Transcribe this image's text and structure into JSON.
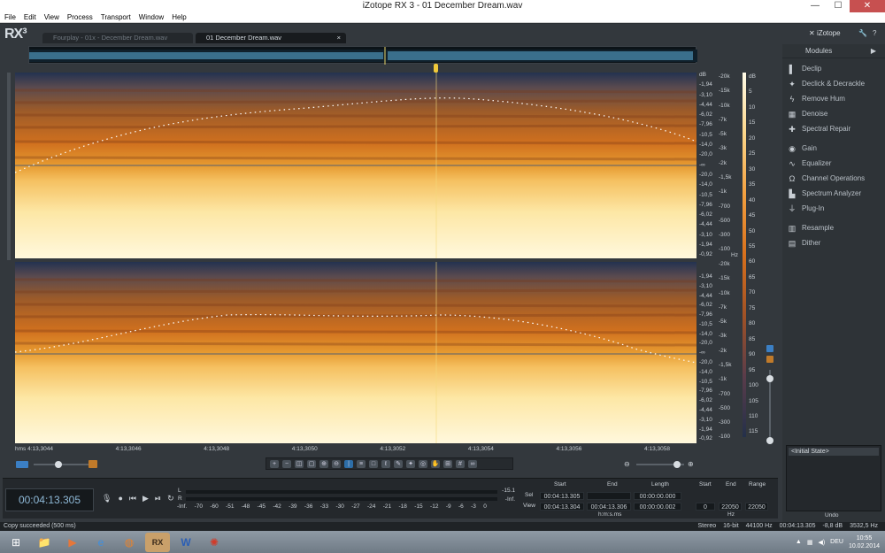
{
  "window": {
    "title": "iZotope RX 3 - 01 December Dream.wav",
    "controls": [
      "—",
      "☐",
      "✕"
    ]
  },
  "menu": [
    "File",
    "Edit",
    "View",
    "Process",
    "Transport",
    "Window",
    "Help"
  ],
  "app": {
    "logo": "RX³",
    "tabs": [
      {
        "label": "Fourplay - 01x - December Dream.wav",
        "active": false
      },
      {
        "label": "01 December Dream.wav",
        "active": true,
        "close": "×"
      }
    ],
    "brand": "iZotope"
  },
  "spectrogram": {
    "db_scale_top": [
      "dB",
      "-1,94",
      "-3,10",
      "-4,44",
      "-6,02",
      "-7,96",
      "-10,5",
      "-14,0",
      "-20,0",
      "-∞",
      "-20,0",
      "-14,0",
      "-10,5",
      "-7,96",
      "-6,02",
      "-4,44",
      "-3,10",
      "-1,94",
      "-0,92"
    ],
    "db_scale_bottom": [
      "-1,94",
      "-3,10",
      "-4,44",
      "-6,02",
      "-7,96",
      "-10,5",
      "-14,0",
      "-20,0",
      "-∞",
      "-20,0",
      "-14,0",
      "-10,5",
      "-7,96",
      "-6,02",
      "-4,44",
      "-3,10",
      "-1,94",
      "-0,92"
    ],
    "hz_scale_top": [
      "-20k",
      "-15k",
      "-10k",
      "-7k",
      "-5k",
      "-3k",
      "-2k",
      "-1,5k",
      "-1k",
      "-700",
      "-500",
      "-300",
      "-100"
    ],
    "hz_scale_top_unit": "Hz",
    "hz_scale_bottom": [
      "-20k",
      "-15k",
      "-10k",
      "-7k",
      "-5k",
      "-3k",
      "-2k",
      "-1,5k",
      "-1k",
      "-700",
      "-500",
      "-300",
      "-100"
    ],
    "color_scale_unit": "dB",
    "color_scale": [
      "5",
      "10",
      "15",
      "20",
      "25",
      "30",
      "35",
      "40",
      "45",
      "50",
      "55",
      "60",
      "65",
      "70",
      "75",
      "80",
      "85",
      "90",
      "95",
      "100",
      "105",
      "110",
      "115"
    ],
    "time_labels": [
      "hms 4:13,3044",
      "4:13,3046",
      "4:13,3048",
      "4:13,3050",
      "4:13,3052",
      "4:13,3054",
      "4:13,3056",
      "4:13,3058"
    ]
  },
  "modules": {
    "header": "Modules",
    "items": [
      {
        "label": "Declip",
        "icon": "declip-icon"
      },
      {
        "label": "Declick & Decrackle",
        "icon": "declick-icon"
      },
      {
        "label": "Remove Hum",
        "icon": "hum-icon"
      },
      {
        "label": "Denoise",
        "icon": "denoise-icon"
      },
      {
        "label": "Spectral Repair",
        "icon": "spectral-repair-icon"
      },
      {
        "label": "Gain",
        "icon": "gain-icon"
      },
      {
        "label": "Equalizer",
        "icon": "equalizer-icon"
      },
      {
        "label": "Channel Operations",
        "icon": "channel-ops-icon"
      },
      {
        "label": "Spectrum Analyzer",
        "icon": "spectrum-analyzer-icon"
      },
      {
        "label": "Plug-In",
        "icon": "plugin-icon"
      },
      {
        "label": "Resample",
        "icon": "resample-icon"
      },
      {
        "label": "Dither",
        "icon": "dither-icon"
      }
    ]
  },
  "history": {
    "item": "<Initial State>",
    "label": "Undo"
  },
  "transport": {
    "timecode": "00:04:13.305",
    "meter_labels": [
      "-Inf.",
      "-70",
      "-60",
      "-51",
      "-48",
      "-45",
      "-42",
      "-39",
      "-36",
      "-33",
      "-30",
      "-27",
      "-24",
      "-21",
      "-18",
      "-15",
      "-12",
      "-9",
      "-6",
      "-3",
      "0"
    ],
    "meter_L": "L",
    "meter_R": "R",
    "meter_right_top": "-15.1",
    "meter_right_bottom": "-Inf."
  },
  "selection": {
    "headers": [
      "Start",
      "End",
      "Length"
    ],
    "sel_label": "Sel",
    "view_label": "View",
    "sel": [
      "00:04:13.305",
      "",
      "00:00:00.000"
    ],
    "view": [
      "00:04:13.304",
      "00:04:13.306",
      "00:00:00.002"
    ],
    "unit": "h:m:s.ms",
    "hz_headers": [
      "Start",
      "End",
      "Range"
    ],
    "hz_values": [
      "0",
      "22050",
      "22050"
    ],
    "hz_unit": "Hz"
  },
  "status": {
    "message": "Copy succeeded (500 ms)",
    "info": [
      "Stereo",
      "16-bit",
      "44100 Hz",
      "00:04:13.305",
      "-8,8 dB",
      "3532,5 Hz"
    ]
  },
  "taskbar": {
    "lang": "DEU",
    "time": "10:55",
    "date": "10.02.2014"
  }
}
